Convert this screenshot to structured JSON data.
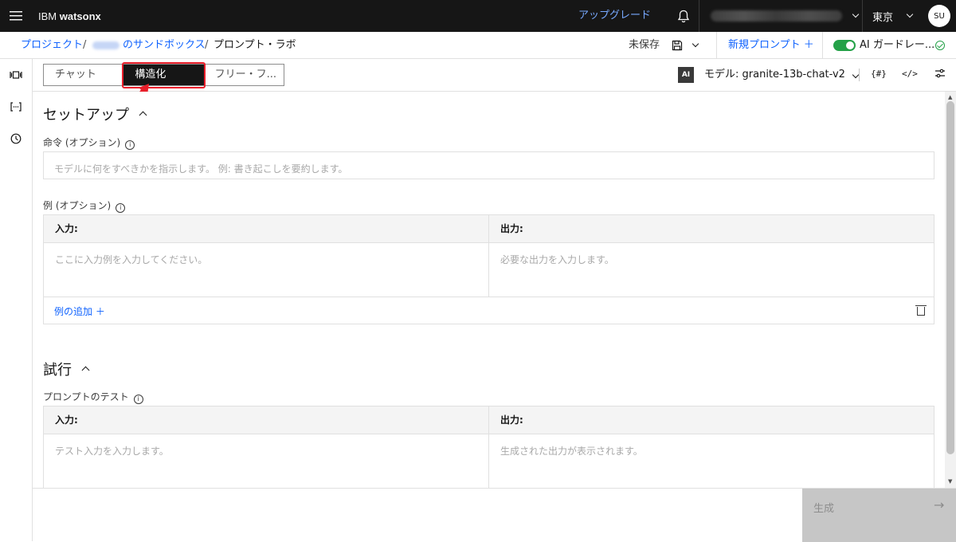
{
  "app": {
    "brand_light": "IBM",
    "brand_bold": "watsonx"
  },
  "header": {
    "upgrade": "アップグレード",
    "region": "東京",
    "avatar": "SU"
  },
  "breadcrumb": {
    "projects": "プロジェクト",
    "sep1": "/",
    "sandbox": "のサンドボックス",
    "sep2": "/",
    "current": "プロンプト・ラボ"
  },
  "status": {
    "unsaved": "未保存",
    "new_prompt": "新規プロンプト ＋",
    "guardrails": "AI ガードレー..."
  },
  "tabs": {
    "chat": "チャット",
    "structured": "構造化",
    "freeform": "フリー・フ..."
  },
  "model": {
    "badge": "AI",
    "label": "モデル: granite-13b-chat-v2"
  },
  "toolbar_icons": {
    "vars": "{#}",
    "code": "</>"
  },
  "setup": {
    "title": "セットアップ",
    "instruction_label": "命令 (オプション)",
    "instruction_placeholder": "モデルに何をすべきかを指示します。 例: 書き起こしを要約します。",
    "examples_label": "例 (オプション)",
    "input_header": "入力:",
    "output_header": "出力:",
    "input_placeholder": "ここに入力例を入力してください。",
    "output_placeholder": "必要な出力を入力します。",
    "add_example": "例の追加 ＋"
  },
  "trial": {
    "title": "試行",
    "test_label": "プロンプトのテスト",
    "input_header": "入力:",
    "output_header": "出力:",
    "input_placeholder": "テスト入力を入力します。",
    "output_placeholder": "生成された出力が表示されます。"
  },
  "footer": {
    "generate": "生成",
    "arrow": "→"
  },
  "colors": {
    "accent": "#0f62fe",
    "highlight": "#e81e2a",
    "toggle": "#24a148",
    "topbar": "#161616"
  }
}
